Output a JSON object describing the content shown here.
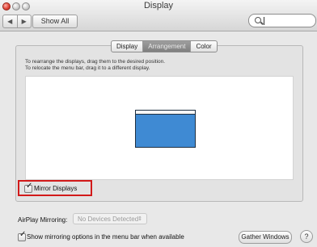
{
  "window": {
    "title": "Display"
  },
  "toolbar": {
    "back_icon": "◀",
    "forward_icon": "▶",
    "show_all_label": "Show All",
    "search_value": ""
  },
  "tabs": [
    {
      "label": "Display",
      "active": false
    },
    {
      "label": "Arrangement",
      "active": true
    },
    {
      "label": "Color",
      "active": false
    }
  ],
  "arrangement": {
    "instruction_line1": "To rearrange the displays, drag them to the desired position.",
    "instruction_line2": "To relocate the menu bar, drag it to a different display.",
    "display_color": "#3f8ad3"
  },
  "mirror": {
    "checked": true,
    "check_glyph": "✓",
    "label": "Mirror Displays",
    "highlight_color": "#d21a1a"
  },
  "airplay": {
    "label": "AirPlay Mirroring:",
    "selected": "No Devices Detected",
    "arrows": "⇕"
  },
  "footer": {
    "show_mirroring_checked": true,
    "check_glyph": "✓",
    "show_mirroring_label": "Show mirroring options in the menu bar when available",
    "gather_windows_label": "Gather Windows",
    "help_label": "?"
  }
}
